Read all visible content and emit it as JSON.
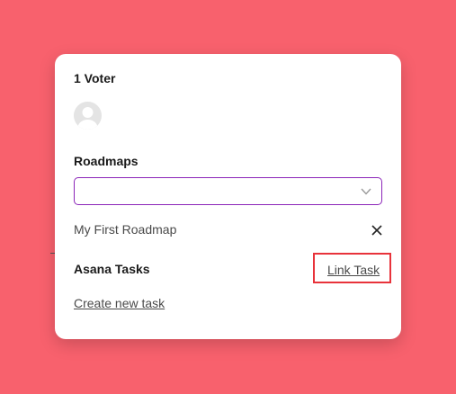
{
  "voters": {
    "title": "1 Voter",
    "avatar_icon": "user-avatar-icon"
  },
  "roadmaps": {
    "title": "Roadmaps",
    "select_value": "",
    "select_icon": "chevron-down-icon",
    "items": [
      {
        "name": "My First Roadmap",
        "remove_icon": "close-icon"
      }
    ]
  },
  "asana": {
    "title": "Asana Tasks",
    "link_task_label": "Link Task",
    "create_task_label": "Create new task",
    "highlight_color": "#e8333b"
  },
  "colors": {
    "background": "#f8616d",
    "select_border": "#8b24b8"
  }
}
